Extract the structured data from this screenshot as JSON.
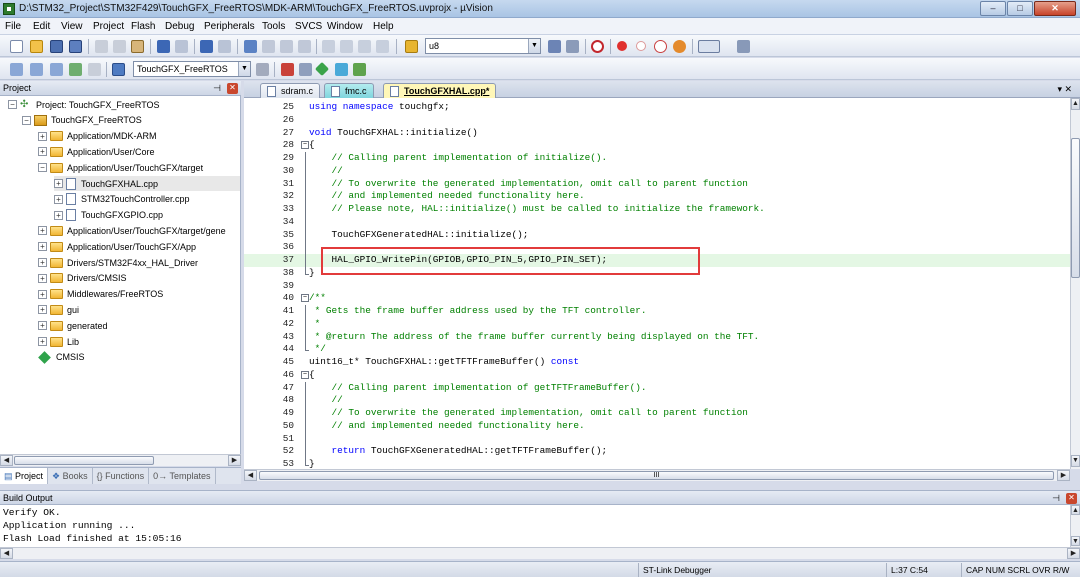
{
  "window": {
    "title": "D:\\STM32_Project\\STM32F429\\TouchGFX_FreeRTOS\\MDK-ARM\\TouchGFX_FreeRTOS.uvprojx - µVision",
    "minimize": "‒",
    "maximize": "□",
    "close": "✕"
  },
  "menu": [
    "File",
    "Edit",
    "View",
    "Project",
    "Flash",
    "Debug",
    "Peripherals",
    "Tools",
    "SVCS",
    "Window",
    "Help"
  ],
  "toolbar": {
    "find_combo": "u8",
    "target_combo": "TouchGFX_FreeRTOS"
  },
  "project_panel": {
    "title": "Project",
    "tree": [
      {
        "label": "Project: TouchGFX_FreeRTOS",
        "level": 0,
        "kind": "project",
        "expander": "−"
      },
      {
        "label": "TouchGFX_FreeRTOS",
        "level": 1,
        "kind": "target",
        "expander": "−"
      },
      {
        "label": "Application/MDK-ARM",
        "level": 2,
        "kind": "folder",
        "expander": "+"
      },
      {
        "label": "Application/User/Core",
        "level": 2,
        "kind": "folder",
        "expander": "+"
      },
      {
        "label": "Application/User/TouchGFX/target",
        "level": 2,
        "kind": "folder",
        "expander": "−"
      },
      {
        "label": "TouchGFXHAL.cpp",
        "level": 3,
        "kind": "file",
        "expander": "+",
        "selected": true
      },
      {
        "label": "STM32TouchController.cpp",
        "level": 3,
        "kind": "file",
        "expander": "+"
      },
      {
        "label": "TouchGFXGPIO.cpp",
        "level": 3,
        "kind": "file",
        "expander": "+"
      },
      {
        "label": "Application/User/TouchGFX/target/gene",
        "level": 2,
        "kind": "folder",
        "expander": "+"
      },
      {
        "label": "Application/User/TouchGFX/App",
        "level": 2,
        "kind": "folder",
        "expander": "+"
      },
      {
        "label": "Drivers/STM32F4xx_HAL_Driver",
        "level": 2,
        "kind": "folder",
        "expander": "+"
      },
      {
        "label": "Drivers/CMSIS",
        "level": 2,
        "kind": "folder",
        "expander": "+"
      },
      {
        "label": "Middlewares/FreeRTOS",
        "level": 2,
        "kind": "folder",
        "expander": "+"
      },
      {
        "label": "gui",
        "level": 2,
        "kind": "folder",
        "expander": "+"
      },
      {
        "label": "generated",
        "level": 2,
        "kind": "folder",
        "expander": "+"
      },
      {
        "label": "Lib",
        "level": 2,
        "kind": "folder",
        "expander": "+"
      },
      {
        "label": "CMSIS",
        "level": 2,
        "kind": "component",
        "expander": ""
      }
    ],
    "tabs": [
      "Project",
      "Books",
      "{} Functions",
      "0→ Templates"
    ]
  },
  "editor": {
    "tabs": [
      {
        "label": "sdram.c",
        "state": "normal"
      },
      {
        "label": "fmc.c",
        "state": "teal"
      },
      {
        "label": "TouchGFXHAL.cpp*",
        "state": "active"
      }
    ],
    "lines": [
      {
        "n": "25",
        "fold": "",
        "tokens": [
          [
            "kw",
            "using namespace"
          ],
          [
            "plain",
            " touchgfx;"
          ]
        ]
      },
      {
        "n": "26",
        "fold": "",
        "tokens": []
      },
      {
        "n": "27",
        "fold": "",
        "tokens": [
          [
            "kw",
            "void"
          ],
          [
            "plain",
            " TouchGFXHAL::initialize()"
          ]
        ]
      },
      {
        "n": "28",
        "fold": "−",
        "tokens": [
          [
            "plain",
            "{"
          ]
        ]
      },
      {
        "n": "29",
        "fold": "",
        "tokens": [
          [
            "cm",
            "    // Calling parent implementation of initialize()."
          ]
        ]
      },
      {
        "n": "30",
        "fold": "",
        "tokens": [
          [
            "cm",
            "    //"
          ]
        ]
      },
      {
        "n": "31",
        "fold": "",
        "tokens": [
          [
            "cm",
            "    // To overwrite the generated implementation, omit call to parent function"
          ]
        ]
      },
      {
        "n": "32",
        "fold": "",
        "tokens": [
          [
            "cm",
            "    // and implemented needed functionality here."
          ]
        ]
      },
      {
        "n": "33",
        "fold": "",
        "tokens": [
          [
            "cm",
            "    // Please note, HAL::initialize() must be called to initialize the framework."
          ]
        ]
      },
      {
        "n": "34",
        "fold": "",
        "tokens": []
      },
      {
        "n": "35",
        "fold": "",
        "tokens": [
          [
            "plain",
            "    TouchGFXGeneratedHAL::initialize();"
          ]
        ]
      },
      {
        "n": "36",
        "fold": "",
        "tokens": []
      },
      {
        "n": "37",
        "fold": "",
        "hl": true,
        "tokens": [
          [
            "plain",
            "    HAL_GPIO_WritePin(GPIOB,GPIO_PIN_5,GPIO_PIN_SET);"
          ]
        ]
      },
      {
        "n": "38",
        "fold": "end",
        "tokens": [
          [
            "plain",
            "}"
          ]
        ]
      },
      {
        "n": "39",
        "fold": "",
        "tokens": []
      },
      {
        "n": "40",
        "fold": "−",
        "tokens": [
          [
            "cm",
            "/**"
          ]
        ]
      },
      {
        "n": "41",
        "fold": "",
        "tokens": [
          [
            "cm",
            " * Gets the frame buffer address used by the TFT controller."
          ]
        ]
      },
      {
        "n": "42",
        "fold": "",
        "tokens": [
          [
            "cm",
            " *"
          ]
        ]
      },
      {
        "n": "43",
        "fold": "",
        "tokens": [
          [
            "cm",
            " * @return The address of the frame buffer currently being displayed on the TFT."
          ]
        ]
      },
      {
        "n": "44",
        "fold": "end",
        "tokens": [
          [
            "cm",
            " */"
          ]
        ]
      },
      {
        "n": "45",
        "fold": "",
        "tokens": [
          [
            "plain",
            "uint16_t* TouchGFXHAL::getTFTFrameBuffer() "
          ],
          [
            "kw",
            "const"
          ]
        ]
      },
      {
        "n": "46",
        "fold": "−",
        "tokens": [
          [
            "plain",
            "{"
          ]
        ]
      },
      {
        "n": "47",
        "fold": "",
        "tokens": [
          [
            "cm",
            "    // Calling parent implementation of getTFTFrameBuffer()."
          ]
        ]
      },
      {
        "n": "48",
        "fold": "",
        "tokens": [
          [
            "cm",
            "    //"
          ]
        ]
      },
      {
        "n": "49",
        "fold": "",
        "tokens": [
          [
            "cm",
            "    // To overwrite the generated implementation, omit call to parent function"
          ]
        ]
      },
      {
        "n": "50",
        "fold": "",
        "tokens": [
          [
            "cm",
            "    // and implemented needed functionality here."
          ]
        ]
      },
      {
        "n": "51",
        "fold": "",
        "tokens": []
      },
      {
        "n": "52",
        "fold": "",
        "tokens": [
          [
            "kw",
            "    return"
          ],
          [
            "plain",
            " TouchGFXGeneratedHAL::getTFTFrameBuffer();"
          ]
        ]
      },
      {
        "n": "53",
        "fold": "end",
        "tokens": [
          [
            "plain",
            "}"
          ]
        ]
      }
    ],
    "hscroll_mark": "III"
  },
  "build_output": {
    "title": "Build Output",
    "lines": [
      "Verify OK.",
      "Application running ...",
      "Flash Load finished at 15:05:16"
    ]
  },
  "status": {
    "debugger": "ST-Link Debugger",
    "position": "L:37 C:54",
    "flags": "CAP  NUM  SCRL  OVR  R/W"
  },
  "colors": {
    "keyword": "#0000ff",
    "comment": "#008000",
    "highlight_box": "#e23b3b",
    "current_line": "#e4f7e4"
  }
}
